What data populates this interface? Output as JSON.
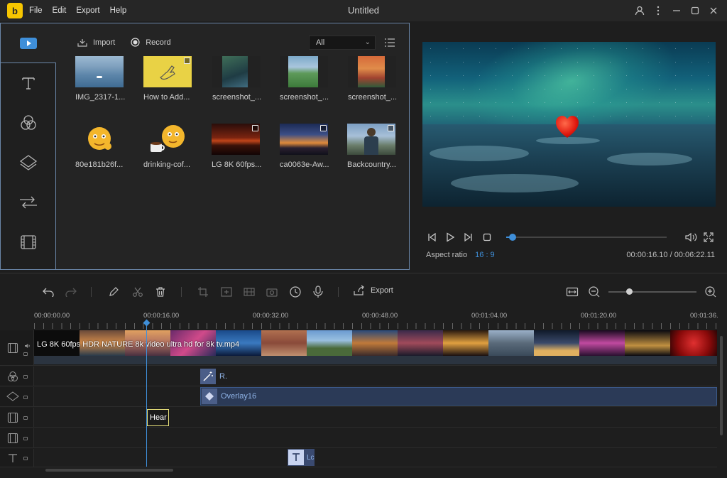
{
  "app": {
    "title": "Untitled",
    "logo_letter": "b"
  },
  "menu": [
    "File",
    "Edit",
    "Export",
    "Help"
  ],
  "media": {
    "import_label": "Import",
    "record_label": "Record",
    "filter_value": "All",
    "items": [
      {
        "caption": "IMG_2317-1...",
        "thumb": "sea-boat",
        "badge": false
      },
      {
        "caption": "How to Add...",
        "thumb": "yellow-hand",
        "badge": true
      },
      {
        "caption": "screenshot_...",
        "thumb": "phone-screenshot",
        "badge": false
      },
      {
        "caption": "screenshot_...",
        "thumb": "green-landscape",
        "badge": false
      },
      {
        "caption": "screenshot_...",
        "thumb": "red-sky",
        "badge": false
      },
      {
        "caption": "80e181b26f...",
        "thumb": "emoji-face",
        "badge": false
      },
      {
        "caption": "drinking-cof...",
        "thumb": "emoji-coffee",
        "badge": false
      },
      {
        "caption": "LG 8K 60fps...",
        "thumb": "sunset-red",
        "badge": true
      },
      {
        "caption": "ca0063e-Aw...",
        "thumb": "sunset-blue",
        "badge": true
      },
      {
        "caption": "Backcountry...",
        "thumb": "hiker",
        "badge": true
      }
    ]
  },
  "preview": {
    "aspect_label": "Aspect ratio",
    "aspect_value": "16 : 9",
    "timecode": "00:00:16.10 / 00:06:22.11",
    "progress": 0.042
  },
  "timeline": {
    "export_label": "Export",
    "ruler": [
      "00:00:00.00",
      "00:00:16.00",
      "00:00:32.00",
      "00:00:48.00",
      "00:01:04.00",
      "00:01:20.00",
      "00:01:36."
    ],
    "video_caption": "LG 8K 60fps HDR NATURE 8k video ultra hd for 8k tv.mp4",
    "effect_clip_label": "R.",
    "overlay_clip_label": "Overlay16",
    "heart_clip_label": "Hear",
    "text_clip_label": "Lc",
    "zoom_level": 0.23
  },
  "colors": {
    "accent": "#3f8fd9",
    "panel_border": "#6a86a8"
  }
}
